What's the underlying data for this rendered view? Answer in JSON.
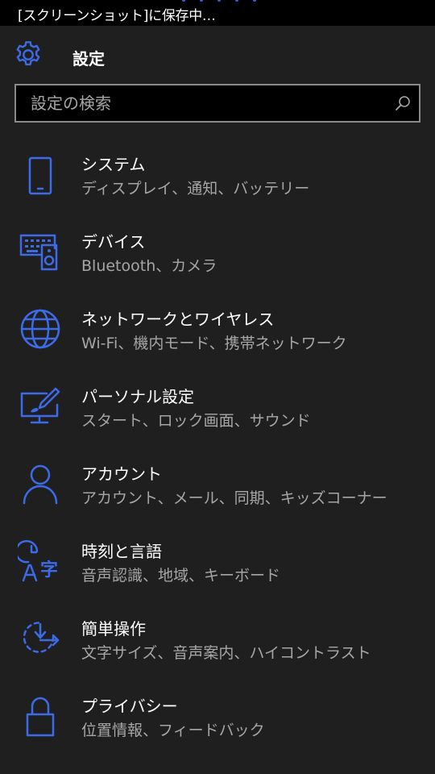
{
  "status_bar": {
    "text": "[スクリーンショット]に保存中…"
  },
  "header": {
    "title": "設定"
  },
  "search": {
    "placeholder": "設定の検索",
    "value": ""
  },
  "accent_color": "#3d6be8",
  "items": [
    {
      "title": "システム",
      "subtitle": "ディスプレイ、通知、バッテリー",
      "icon": "phone-icon"
    },
    {
      "title": "デバイス",
      "subtitle": "Bluetooth、カメラ",
      "icon": "devices-icon"
    },
    {
      "title": "ネットワークとワイヤレス",
      "subtitle": "Wi-Fi、機内モード、携帯ネットワーク",
      "icon": "globe-icon"
    },
    {
      "title": "パーソナル設定",
      "subtitle": "スタート、ロック画面、サウンド",
      "icon": "personalization-icon"
    },
    {
      "title": "アカウント",
      "subtitle": "アカウント、メール、同期、キッズコーナー",
      "icon": "person-icon"
    },
    {
      "title": "時刻と言語",
      "subtitle": "音声認識、地域、キーボード",
      "icon": "time-language-icon"
    },
    {
      "title": "簡単操作",
      "subtitle": "文字サイズ、音声案内、ハイコントラスト",
      "icon": "ease-of-access-icon"
    },
    {
      "title": "プライバシー",
      "subtitle": "位置情報、フィードバック",
      "icon": "lock-icon"
    }
  ]
}
